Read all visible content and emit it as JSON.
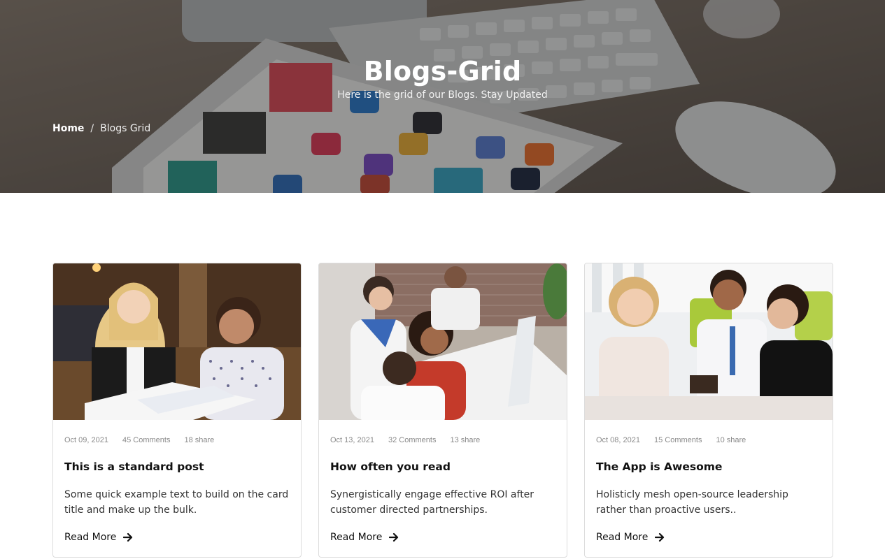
{
  "hero": {
    "title": "Blogs-Grid",
    "subtitle": "Here is the grid of our Blogs. Stay Updated"
  },
  "breadcrumb": {
    "home": "Home",
    "separator": "/",
    "current": "Blogs Grid"
  },
  "posts": [
    {
      "date": "Oct 09, 2021",
      "comments": "45 Comments",
      "shares": "18 share",
      "title": "This is a standard post",
      "excerpt": "Some quick example text to build on the card title and make up the bulk.",
      "read_more": "Read More"
    },
    {
      "date": "Oct 13, 2021",
      "comments": "32 Comments",
      "shares": "13 share",
      "title": "How often you read",
      "excerpt": "Synergistically engage effective ROI after customer directed partnerships.",
      "read_more": "Read More"
    },
    {
      "date": "Oct 08, 2021",
      "comments": "15 Comments",
      "shares": "10 share",
      "title": "The App is Awesome",
      "excerpt": "Holisticly mesh open-source leadership rather than proactive users..",
      "read_more": "Read More"
    }
  ],
  "icons": {
    "read_more": "arrow-right-icon"
  }
}
